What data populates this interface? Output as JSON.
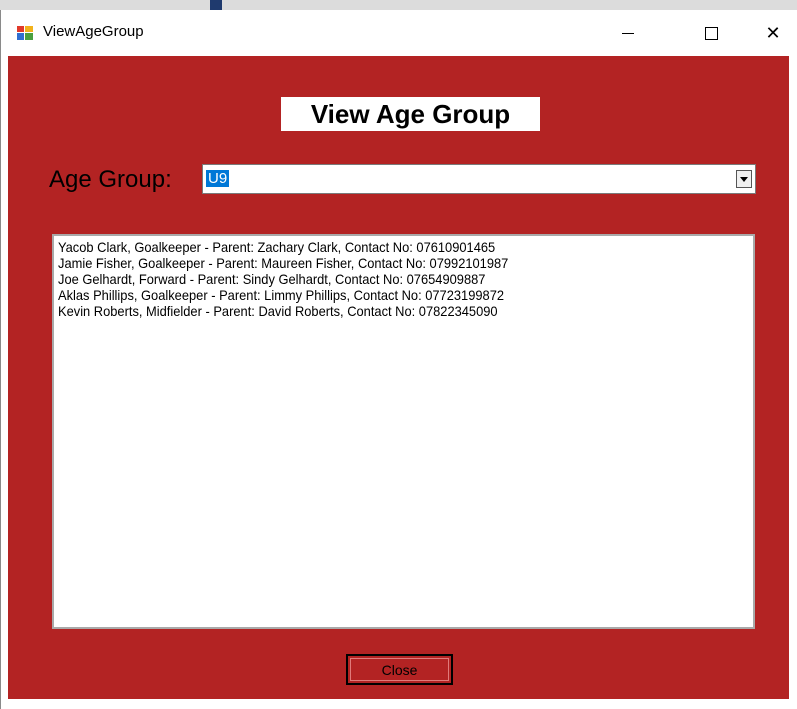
{
  "window": {
    "title": "ViewAgeGroup",
    "controls": {
      "minimize": "—",
      "maximize": "□",
      "close": "✕"
    }
  },
  "form": {
    "heading": "View Age Group",
    "age_group_label": "Age Group:",
    "age_group_selected": "U9"
  },
  "players": [
    "Yacob Clark, Goalkeeper - Parent: Zachary Clark, Contact No: 07610901465",
    "Jamie Fisher, Goalkeeper - Parent: Maureen Fisher, Contact No: 07992101987",
    "Joe Gelhardt, Forward - Parent: Sindy Gelhardt, Contact No: 07654909887",
    "Aklas Phillips, Goalkeeper - Parent: Limmy Phillips, Contact No: 07723199872",
    "Kevin Roberts, Midfielder - Parent: David Roberts, Contact No: 07822345090"
  ],
  "buttons": {
    "close_label": "Close"
  },
  "colors": {
    "form_background": "#b32323",
    "selection": "#0078d7"
  },
  "icons": {
    "app": "windows-form-icon",
    "dropdown": "chevron-down-icon"
  }
}
